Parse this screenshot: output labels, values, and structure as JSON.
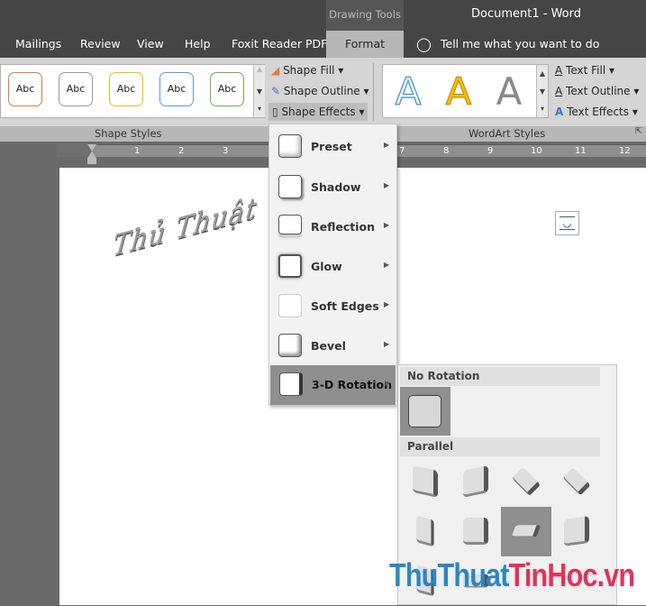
{
  "titlebar": {
    "context_tab": "Drawing Tools",
    "title": "Document1  -  Word"
  },
  "tabs": [
    {
      "label": "Mailings"
    },
    {
      "label": "Review"
    },
    {
      "label": "View"
    },
    {
      "label": "Help"
    },
    {
      "label": "Foxit Reader PDF"
    },
    {
      "label": "Format",
      "active": true
    }
  ],
  "tell_me": "Tell me what you want to do",
  "shape_styles": {
    "label": "Shape Styles",
    "swatches": [
      {
        "text": "Abc",
        "color": "#e07b39"
      },
      {
        "text": "Abc",
        "color": "#9a9a9a"
      },
      {
        "text": "Abc",
        "color": "#f0c000"
      },
      {
        "text": "Abc",
        "color": "#5b9bd5"
      },
      {
        "text": "Abc",
        "color": "#70ad47"
      }
    ],
    "commands": [
      {
        "label": "Shape Fill",
        "icon": "paint-bucket-icon"
      },
      {
        "label": "Shape Outline",
        "icon": "pen-icon"
      },
      {
        "label": "Shape Effects",
        "icon": "shape-effects-icon"
      }
    ]
  },
  "wordart_styles": {
    "label": "WordArt Styles",
    "samples": [
      {
        "text": "A",
        "style": "outline-blue"
      },
      {
        "text": "A",
        "style": "gold"
      },
      {
        "text": "A",
        "style": "gray"
      }
    ],
    "commands": [
      {
        "label": "Text Fill"
      },
      {
        "label": "Text Outline"
      },
      {
        "label": "Text Effects"
      }
    ]
  },
  "ruler": {
    "numbers": [
      "1",
      "2",
      "3",
      "7",
      "8",
      "9",
      "10",
      "11",
      "12"
    ]
  },
  "document": {
    "wordart_text": "Thủ Thuật Tin Học"
  },
  "shape_effects_menu": {
    "items": [
      {
        "label": "Preset",
        "key": "P"
      },
      {
        "label": "Shadow",
        "key": "S"
      },
      {
        "label": "Reflection",
        "key": "R"
      },
      {
        "label": "Glow",
        "key": "G"
      },
      {
        "label": "Soft Edges",
        "key": "E"
      },
      {
        "label": "Bevel",
        "key": "B"
      },
      {
        "label": "3-D Rotation",
        "key": "D",
        "active": true
      }
    ]
  },
  "rotation_submenu": {
    "sections": [
      {
        "title": "No Rotation"
      },
      {
        "title": "Parallel"
      }
    ],
    "selected_parallel_index": 6
  },
  "watermark": {
    "part1": "ThuThuat",
    "part2": "TinHoc",
    "part3": ".vn",
    "color1": "#2e86c1",
    "color2": "#e0345a"
  }
}
